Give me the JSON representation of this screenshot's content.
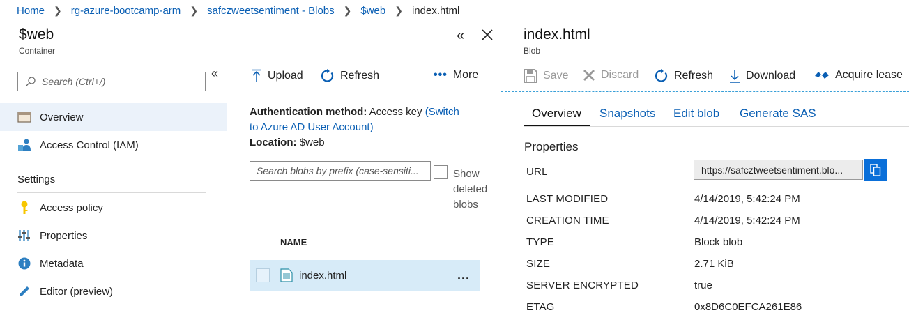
{
  "breadcrumb": {
    "items": [
      "Home",
      "rg-azure-bootcamp-arm",
      "safczweetsentiment - Blobs",
      "$web"
    ],
    "current": "index.html"
  },
  "container_blade": {
    "title": "$web",
    "subtitle": "Container",
    "collapse_icon": "double-chevron-left-icon",
    "close_icon": "close-icon"
  },
  "sidebar": {
    "search_placeholder": "Search (Ctrl+/)",
    "items": [
      {
        "label": "Overview",
        "icon": "overview-icon"
      },
      {
        "label": "Access Control (IAM)",
        "icon": "iam-icon"
      }
    ],
    "settings_heading": "Settings",
    "settings_items": [
      {
        "label": "Access policy",
        "icon": "key-icon"
      },
      {
        "label": "Properties",
        "icon": "properties-icon"
      },
      {
        "label": "Metadata",
        "icon": "info-icon"
      },
      {
        "label": "Editor (preview)",
        "icon": "pencil-icon"
      }
    ]
  },
  "container_toolbar": {
    "upload": "Upload",
    "refresh": "Refresh",
    "more": "More"
  },
  "container_info": {
    "auth_label": "Authentication method:",
    "auth_value": "Access key",
    "auth_link_line1": "(Switch",
    "auth_link_line2": "to Azure AD User Account)",
    "location_label": "Location:",
    "location_value": "$web"
  },
  "blob_search": {
    "placeholder": "Search blobs by prefix (case-sensiti...",
    "show_deleted_line1": "Show",
    "show_deleted_line2": "deleted",
    "show_deleted_line3": "blobs"
  },
  "blob_table": {
    "header_name": "NAME",
    "rows": [
      {
        "name": "index.html",
        "more": "..."
      }
    ]
  },
  "blob_blade": {
    "title": "index.html",
    "subtitle": "Blob"
  },
  "blob_toolbar": {
    "save": "Save",
    "discard": "Discard",
    "refresh": "Refresh",
    "download": "Download",
    "acquire_lease": "Acquire lease"
  },
  "blob_tabs": [
    "Overview",
    "Snapshots",
    "Edit blob",
    "Generate SAS"
  ],
  "properties": {
    "heading": "Properties",
    "url_label": "URL",
    "url_value": "https://safcztweetsentiment.blo...",
    "rows": [
      {
        "label": "LAST MODIFIED",
        "value": "4/14/2019, 5:42:24 PM"
      },
      {
        "label": "CREATION TIME",
        "value": "4/14/2019, 5:42:24 PM"
      },
      {
        "label": "TYPE",
        "value": "Block blob"
      },
      {
        "label": "SIZE",
        "value": "2.71 KiB"
      },
      {
        "label": "SERVER ENCRYPTED",
        "value": "true"
      },
      {
        "label": "ETAG",
        "value": "0x8D6C0EFCA261E86"
      }
    ]
  },
  "colors": {
    "accent": "#0a5fb4",
    "active_nav": "#ebf2fa",
    "selected_row": "#d7ebf8",
    "copy_button": "#0a6fd9"
  }
}
